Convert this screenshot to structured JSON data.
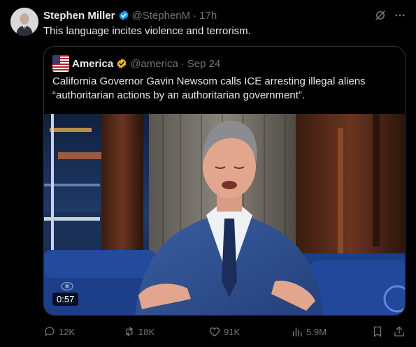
{
  "author": {
    "name": "Stephen Miller",
    "handle": "@StephenM",
    "time": "17h",
    "text": "This language incites violence and terrorism."
  },
  "quote": {
    "name": "America",
    "handle": "@america",
    "time": "Sep 24",
    "text_line1": "California Governor Gavin Newsom calls ICE arresting illegal aliens",
    "text_line2": "“authoritarian actions by an authoritarian government”."
  },
  "video": {
    "duration": "0:57"
  },
  "actions": {
    "replies": "12K",
    "reposts": "18K",
    "likes": "91K",
    "views": "5.9M"
  },
  "colors": {
    "background": "#000000",
    "text_primary": "#e7e9ea",
    "text_secondary": "#71767b",
    "verified_blue": "#1d9bf0",
    "verified_gold": "#e8b829"
  },
  "icons": [
    "verified-badge-icon",
    "grok-icon",
    "more-icon",
    "flag-icon",
    "gold-badge-icon",
    "reply-icon",
    "repost-icon",
    "like-icon",
    "views-icon",
    "bookmark-icon",
    "share-icon"
  ]
}
